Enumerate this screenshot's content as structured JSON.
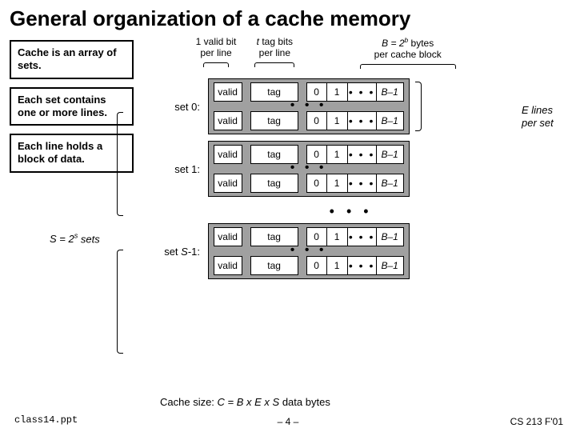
{
  "title": "General organization of a cache memory",
  "box1": "Cache is an array of sets.",
  "box2": "Each set contains one or more lines.",
  "box3": "Each line holds a block of data.",
  "sets_label_prefix": "S = 2",
  "sets_label_exp": "s",
  "sets_label_suffix": " sets",
  "e_label_prefix": "E",
  "e_label_suffix": " lines per set",
  "top": {
    "valid_l1": "1 valid bit",
    "valid_l2": "per line",
    "tag_l1_prefix": "t",
    "tag_l1_suffix": " tag bits",
    "tag_l2": "per line",
    "bytes_prefix": "B = 2",
    "bytes_exp": "b",
    "bytes_suffix": " bytes",
    "bytes_l2": "per cache block"
  },
  "cells": {
    "valid": "valid",
    "tag": "tag",
    "b0": "0",
    "b1": "1",
    "dots": "• • •",
    "blast_prefix": "B",
    "blast_suffix": "–1"
  },
  "setlabels": [
    "set 0:",
    "set 1:",
    "set S-1:"
  ],
  "setlabel_last_html": "set <i>S</i>-1:",
  "vdots": "• • •",
  "csize_prefix": "Cache size:  ",
  "csize_body": "C = B x E x S",
  "csize_suffix": " data bytes",
  "footer": {
    "file": "class14.ppt",
    "page": "– 4 –",
    "course": "CS 213 F'01"
  }
}
